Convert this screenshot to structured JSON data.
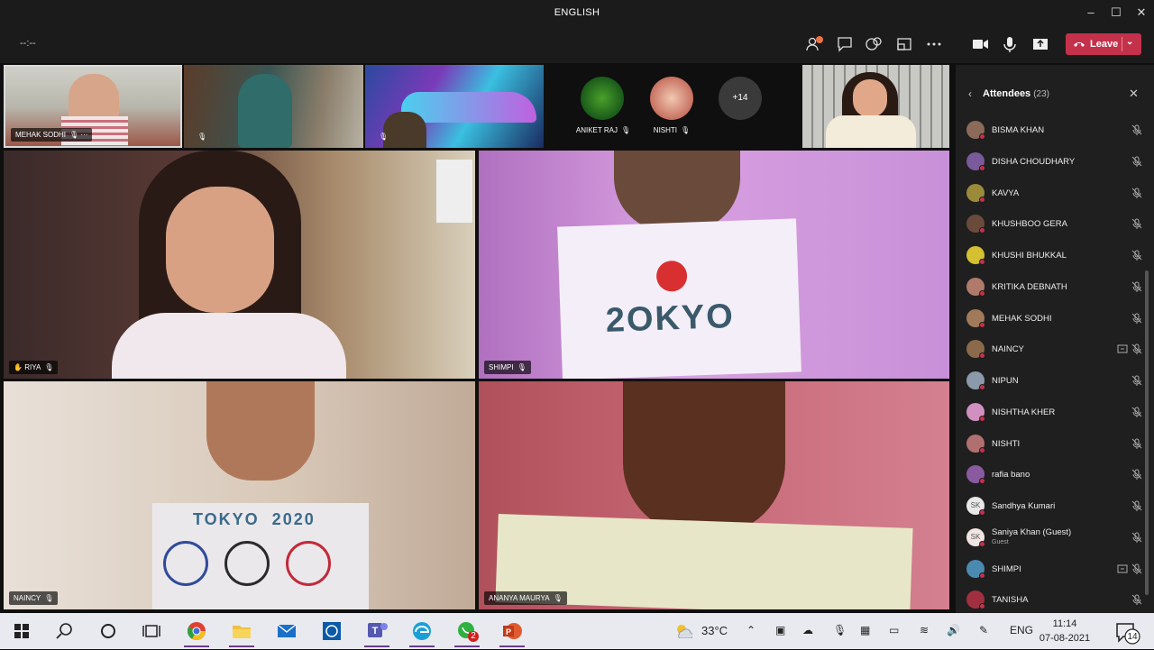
{
  "window": {
    "title": "ENGLISH"
  },
  "toolbar": {
    "timer": "--:--",
    "leave_label": "Leave"
  },
  "top_strip": {
    "tiles": [
      {
        "name": "MEHAK SODHI",
        "more": "···"
      },
      {
        "name": ""
      },
      {
        "name": ""
      }
    ],
    "avatars": [
      {
        "name": "ANIKET RAJ"
      },
      {
        "name": "NISHTI"
      }
    ],
    "overflow": "+14"
  },
  "main_grid": [
    {
      "name": "RIYA"
    },
    {
      "name": "SHIMPI",
      "sign_text": "2OKYO"
    },
    {
      "name": "NAINCY",
      "sign_text": "TOKYO  2020"
    },
    {
      "name": "ANANYA MAURYA"
    }
  ],
  "attendees": {
    "title": "Attendees",
    "count": "(23)",
    "list": [
      {
        "name": "BISMA KHAN",
        "color": "#8b6a5a"
      },
      {
        "name": "DISHA CHOUDHARY",
        "color": "#7a5a9a"
      },
      {
        "name": "KAVYA",
        "color": "#9a8a3a"
      },
      {
        "name": "KHUSHBOO GERA",
        "color": "#6a4a3a"
      },
      {
        "name": "KHUSHI BHUKKAL",
        "color": "#d4c030"
      },
      {
        "name": "KRITIKA DEBNATH",
        "color": "#b07a6a"
      },
      {
        "name": "MEHAK SODHI",
        "color": "#a07a5a"
      },
      {
        "name": "NAINCY",
        "color": "#8a6a4a",
        "sharing": true
      },
      {
        "name": "NIPUN",
        "color": "#8a9aaa"
      },
      {
        "name": "NISHTHA KHER",
        "color": "#d090c0"
      },
      {
        "name": "NISHTI",
        "color": "#b07070"
      },
      {
        "name": "rafia bano",
        "color": "#8a5aa0"
      },
      {
        "name": "Sandhya Kumari",
        "initials": "SK",
        "color": "#e8e8e8"
      },
      {
        "name": "Saniya Khan (Guest)",
        "sub": "Guest",
        "initials": "SK",
        "color": "#f0e4e4"
      },
      {
        "name": "SHIMPI",
        "color": "#4a8ab0",
        "sharing": true
      },
      {
        "name": "TANISHA",
        "color": "#a03040"
      }
    ]
  },
  "taskbar": {
    "temperature": "33°C",
    "language": "ENG",
    "time": "11:14",
    "date": "07-08-2021",
    "whatsapp_badge": "2",
    "notification_count": "14"
  }
}
